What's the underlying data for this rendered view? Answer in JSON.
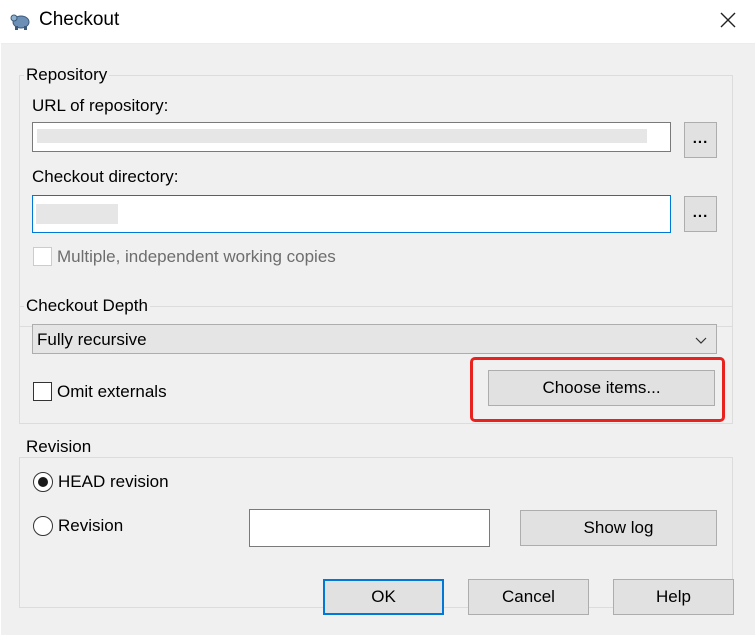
{
  "window": {
    "title": "Checkout",
    "close_icon": "close-icon",
    "app_icon": "tortoise-icon"
  },
  "repository": {
    "group_label": "Repository",
    "url_label": "URL of repository:",
    "url_value": "",
    "directory_label": "Checkout directory:",
    "directory_value": "",
    "browse_label": "...",
    "multiple_copies_label": "Multiple, independent working copies",
    "multiple_copies_checked": false,
    "multiple_copies_enabled": false
  },
  "depth": {
    "group_label": "Checkout Depth",
    "selected": "Fully recursive",
    "omit_externals_label": "Omit externals",
    "omit_externals_checked": false,
    "choose_items_label": "Choose items...",
    "highlight_color": "#e8231f"
  },
  "revision": {
    "group_label": "Revision",
    "head_label": "HEAD revision",
    "head_selected": true,
    "revision_label": "Revision",
    "revision_value": "",
    "show_log_label": "Show log"
  },
  "buttons": {
    "ok": "OK",
    "cancel": "Cancel",
    "help": "Help"
  },
  "colors": {
    "accent": "#0078d7",
    "dialog_bg": "#f0f0f0",
    "highlight": "#e8231f"
  }
}
